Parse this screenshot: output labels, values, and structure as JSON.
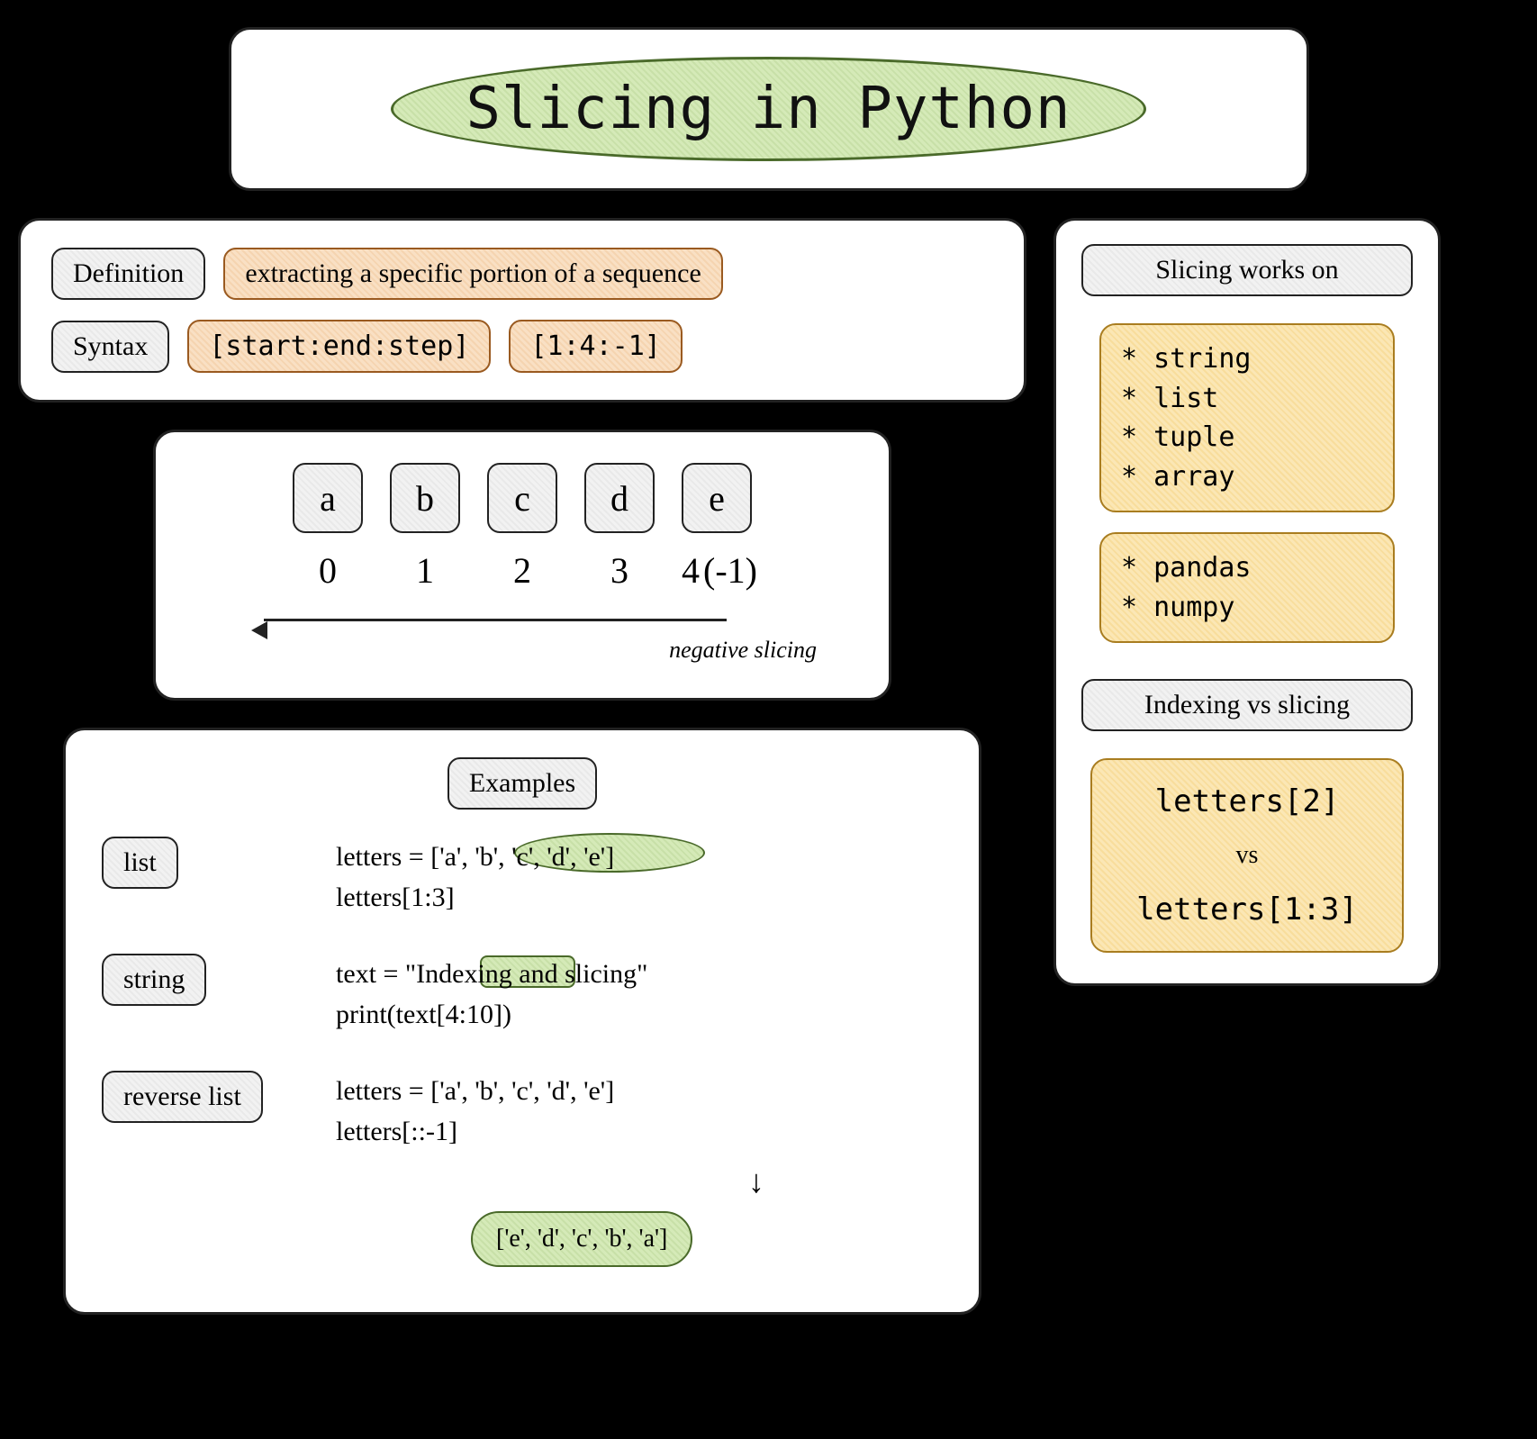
{
  "title": "Slicing in Python",
  "definition": {
    "label": "Definition",
    "text": "extracting a specific portion of a sequence"
  },
  "syntax": {
    "label": "Syntax",
    "pattern": "[start:end:step]",
    "example": "[1:4:-1]"
  },
  "letters": {
    "items": [
      "a",
      "b",
      "c",
      "d",
      "e"
    ],
    "indices": [
      "0",
      "1",
      "2",
      "3",
      "4"
    ],
    "negative_suffix": "(-1)",
    "arrow_label": "negative slicing"
  },
  "examples": {
    "heading": "Examples",
    "list": {
      "label": "list",
      "line1": "letters = ['a', 'b', 'c', 'd', 'e']",
      "line2": "letters[1:3]"
    },
    "string": {
      "label": "string",
      "line1": "text = \"Indexing and slicing\"",
      "line2": "print(text[4:10])"
    },
    "reverse": {
      "label": "reverse list",
      "line1": "letters = ['a', 'b', 'c', 'd', 'e']",
      "line2": "letters[::-1]",
      "result": "['e', 'd', 'c', 'b', 'a']"
    }
  },
  "works_on": {
    "heading": "Slicing works on",
    "group1": [
      "string",
      "list",
      "tuple",
      "array"
    ],
    "group2": [
      "pandas",
      "numpy"
    ]
  },
  "indexing_vs_slicing": {
    "heading": "Indexing vs slicing",
    "indexing": "letters[2]",
    "vs": "vs",
    "slicing": "letters[1:3]"
  }
}
